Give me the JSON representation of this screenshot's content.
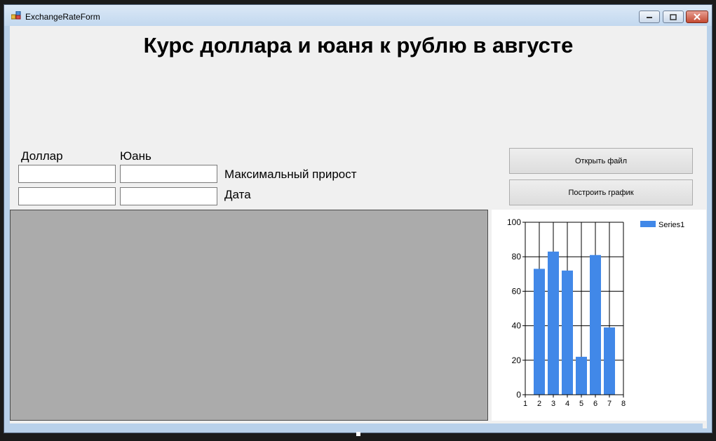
{
  "window": {
    "title": "ExchangeRateForm"
  },
  "heading": "Курс доллара и юаня к рублю в августе",
  "labels": {
    "dollar": "Доллар",
    "yuan": "Юань",
    "max_growth": "Максимальный прирост",
    "date": "Дата"
  },
  "inputs": {
    "dollar_max": "",
    "yuan_max": "",
    "dollar_date": "",
    "yuan_date": ""
  },
  "buttons": {
    "open_file": "Открыть файл",
    "build_chart": "Построить график"
  },
  "chart_data": {
    "type": "bar",
    "categories": [
      2,
      3,
      4,
      5,
      6,
      7
    ],
    "series": [
      {
        "name": "Series1",
        "values": [
          73,
          83,
          72,
          22,
          81,
          39
        ],
        "color": "#4188e8"
      }
    ],
    "xlim": [
      1,
      8
    ],
    "ylim": [
      0,
      100
    ],
    "xticks": [
      "1",
      "2",
      "3",
      "4",
      "5",
      "6",
      "7",
      "8"
    ],
    "yticks": [
      "0",
      "20",
      "40",
      "60",
      "80",
      "100"
    ],
    "grid": true,
    "legend": "top-right"
  }
}
